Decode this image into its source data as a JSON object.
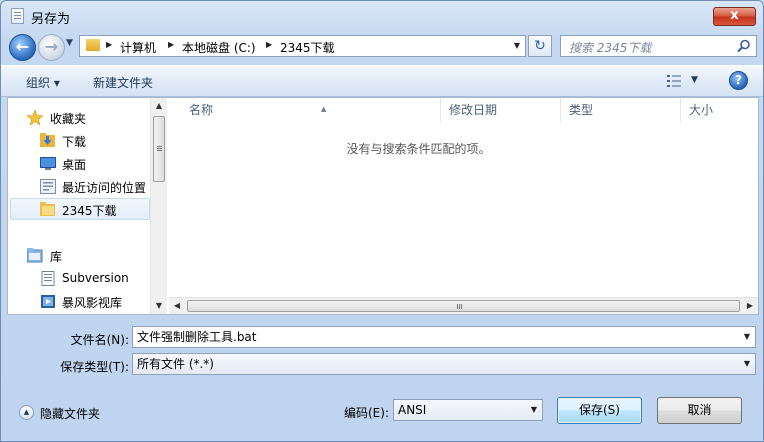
{
  "window": {
    "title": "另存为",
    "close_label": "x"
  },
  "address": {
    "crumbs": [
      "计算机",
      "本地磁盘 (C:)",
      "2345下载"
    ],
    "search_placeholder": "搜索 2345下载"
  },
  "toolbar": {
    "organize": "组织 ▾",
    "new_folder": "新建文件夹",
    "help": "?"
  },
  "nav": {
    "items": [
      {
        "label": "收藏夹",
        "icon": "star-icon"
      },
      {
        "label": "下载",
        "icon": "download-folder-icon"
      },
      {
        "label": "桌面",
        "icon": "desktop-icon"
      },
      {
        "label": "最近访问的位置",
        "icon": "recent-places-icon"
      },
      {
        "label": "2345下载",
        "icon": "folder-icon",
        "selected": true
      },
      {
        "label": "库",
        "icon": "library-icon"
      },
      {
        "label": "Subversion",
        "icon": "document-library-icon"
      },
      {
        "label": "暴风影视库",
        "icon": "video-library-icon"
      }
    ]
  },
  "list": {
    "columns": [
      "名称",
      "修改日期",
      "类型",
      "大小"
    ],
    "empty_message": "没有与搜索条件匹配的项。"
  },
  "form": {
    "filename_label": "文件名(N):",
    "filename_value": "文件强制删除工具.bat",
    "filetype_label": "保存类型(T):",
    "filetype_value": "所有文件 (*.*)",
    "encoding_label": "编码(E):",
    "encoding_value": "ANSI"
  },
  "footer": {
    "hide_folders": "隐藏文件夹",
    "save": "保存(S)",
    "cancel": "取消"
  },
  "colors": {
    "accent": "#2f6fc2",
    "title_bar": "#c4d8f1",
    "close": "#c6321a"
  }
}
